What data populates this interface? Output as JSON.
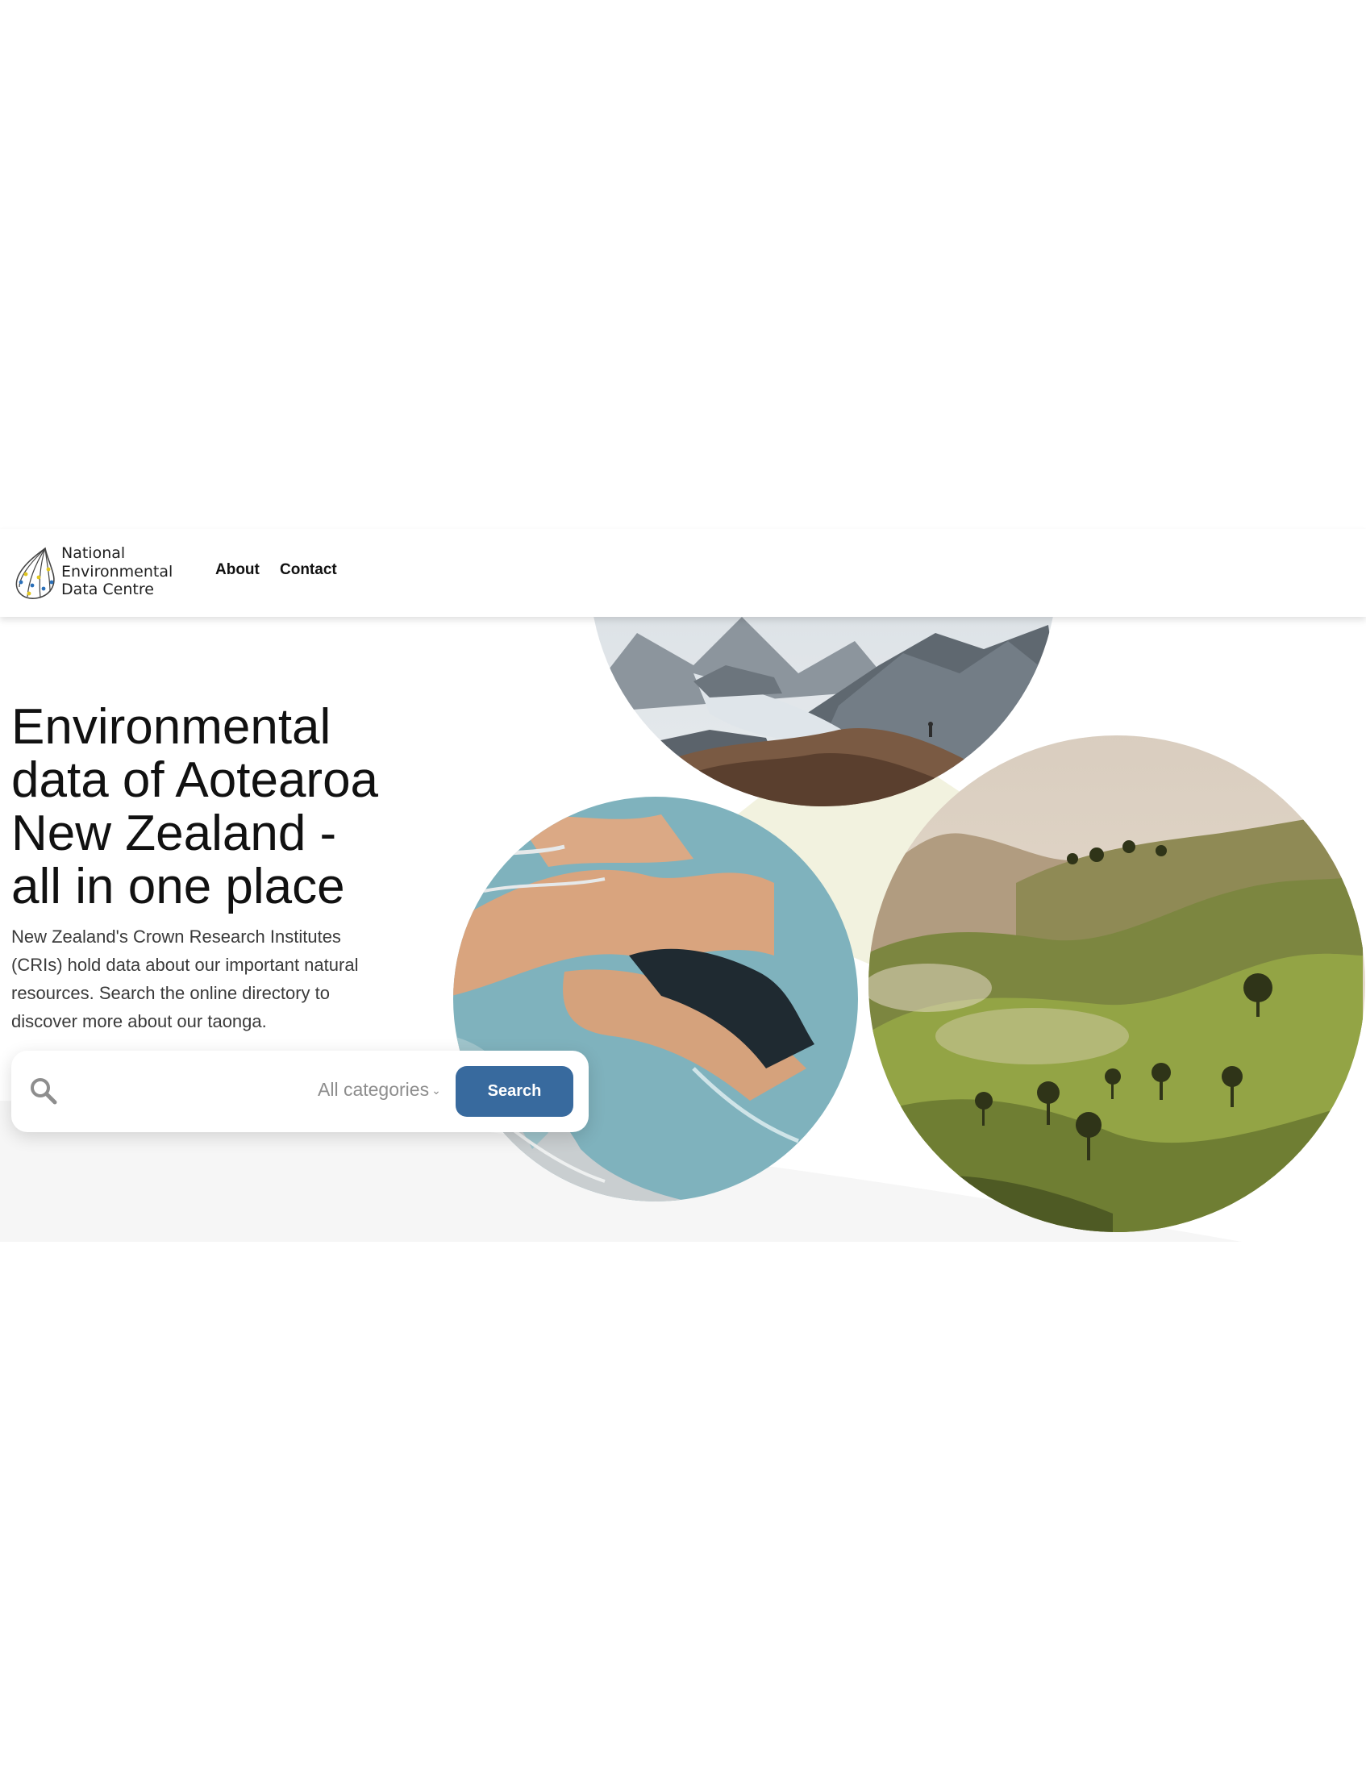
{
  "header": {
    "logo_text": "National\nEnvironmental\nData Centre",
    "nav": {
      "about": "About",
      "contact": "Contact"
    }
  },
  "hero": {
    "title_lines": [
      "Environmental",
      "data of Aotearoa",
      "New Zealand -",
      "all in one place"
    ],
    "description": "New Zealand's Crown Research Institutes (CRIs) hold data about our important natural resources. Search the online directory to discover more about our taonga."
  },
  "search": {
    "placeholder": "",
    "category": "All categories",
    "button_label": "Search"
  },
  "colors": {
    "accent": "#386a9e",
    "title_text": "#111111",
    "body_text": "#3a3a3a",
    "pale_yellow": "#f1f1de",
    "pale_blue": "#e9eff2"
  },
  "images": [
    "mountain-lake-photo",
    "braided-river-aerial-photo",
    "rolling-green-hills-photo"
  ]
}
